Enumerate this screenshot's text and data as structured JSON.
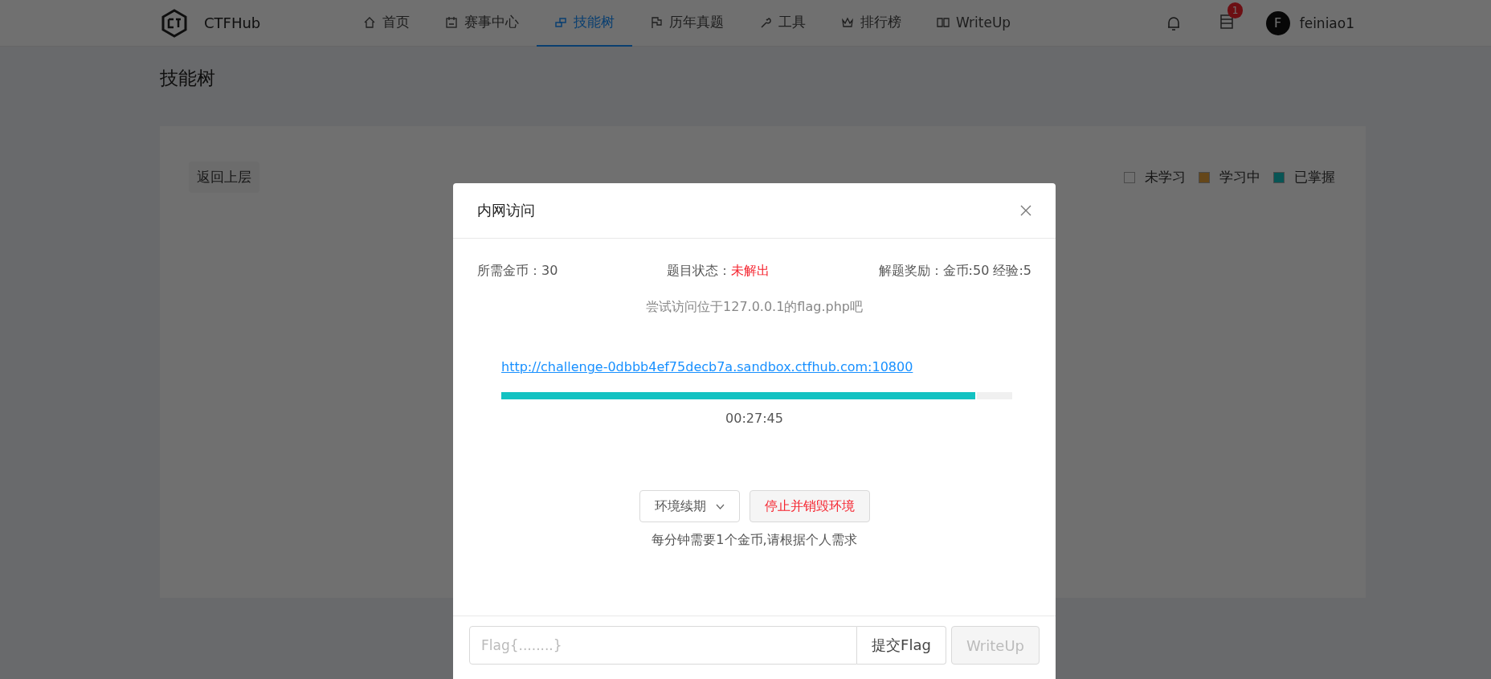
{
  "header": {
    "logo_text": "CTFHub",
    "nav": [
      {
        "label": "首页",
        "kind": "home",
        "selected": false
      },
      {
        "label": "赛事中心",
        "kind": "calendar",
        "selected": false
      },
      {
        "label": "技能树",
        "kind": "tree",
        "selected": true
      },
      {
        "label": "历年真题",
        "kind": "flag",
        "selected": false
      },
      {
        "label": "工具",
        "kind": "wrench",
        "selected": false
      },
      {
        "label": "排行榜",
        "kind": "crown",
        "selected": false
      },
      {
        "label": "WriteUp",
        "kind": "book",
        "selected": false
      }
    ],
    "badge": "1",
    "avatar_letter": "F",
    "username": "feiniao1"
  },
  "page_title": "技能树",
  "back_button": "返回上层",
  "legend": [
    {
      "label": "未学习",
      "color": "#707070"
    },
    {
      "label": "学习中",
      "color": "#65471a"
    },
    {
      "label": "已掌握",
      "color": "#085555"
    }
  ],
  "modal": {
    "title": "内网访问",
    "cost_label": "所需金币：",
    "cost": "30",
    "status_label": "题目状态：",
    "status": "未解出",
    "solved": false,
    "reward_label": "解题奖励：",
    "reward": "金币:50 经验:5",
    "hint": "尝试访问位于127.0.0.1的flag.php吧",
    "url": "http://challenge-0dbbb4ef75decb7a.sandbox.ctfhub.com:10800",
    "progress": {
      "level": 0.925
    },
    "timer": "00:27:45",
    "renew_button": "环境续期",
    "stop_button": "停止并销毁环境",
    "note": "每分钟需要1个金币,请根据个人需求",
    "flag_input": {
      "placeholder": "Flag{........}"
    },
    "submit_button": "提交Flag",
    "writeup_button": {
      "label": "WriteUp",
      "disabled": true
    }
  }
}
